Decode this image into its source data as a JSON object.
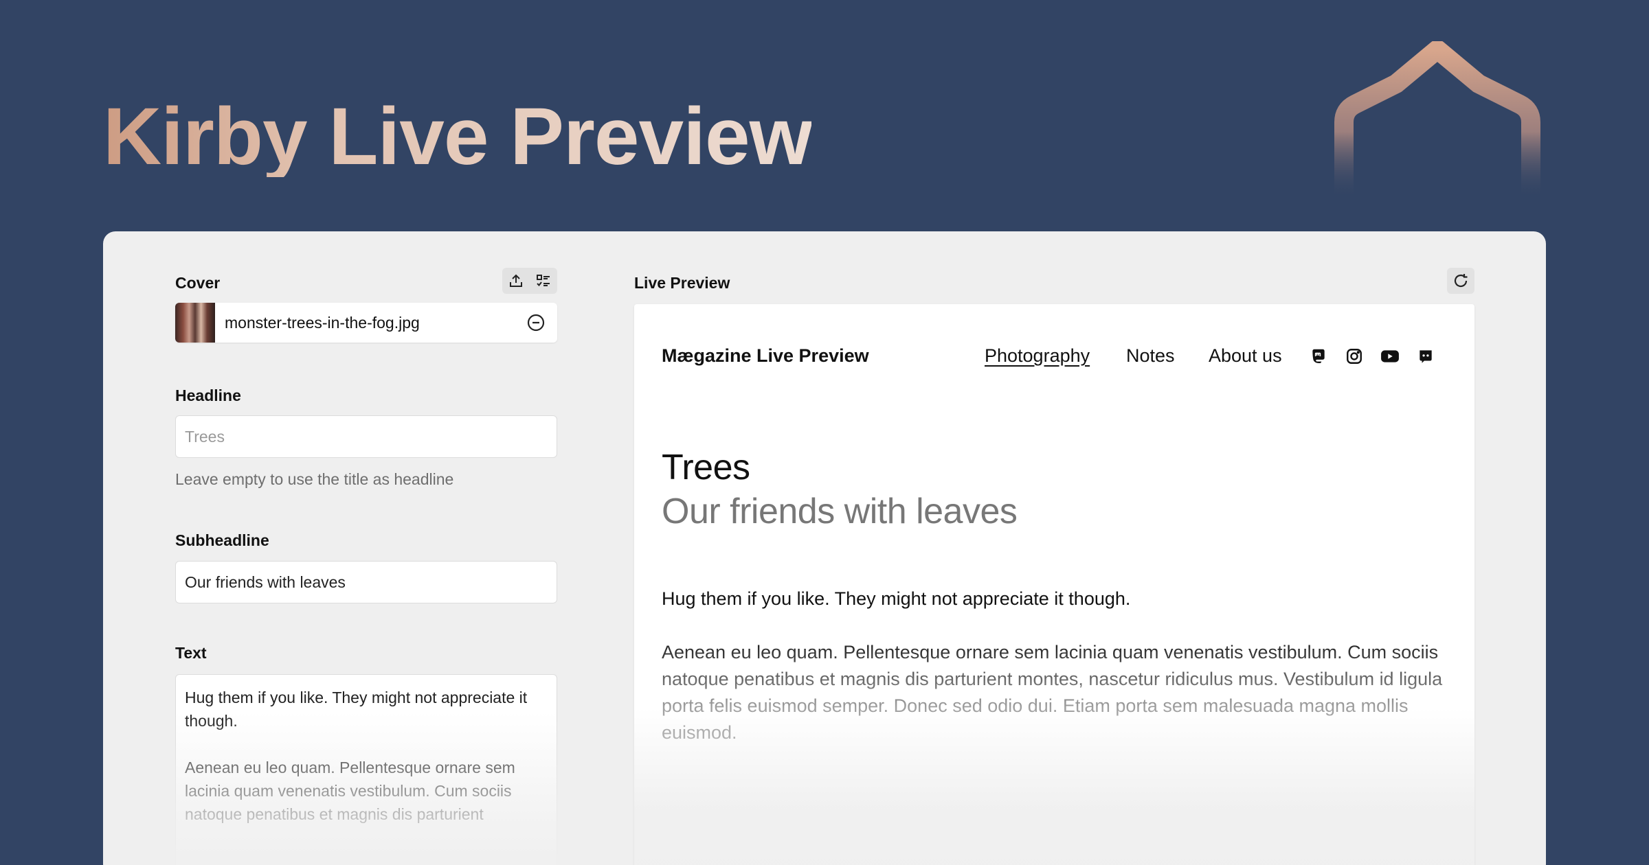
{
  "hero": {
    "title": "Kirby Live Preview"
  },
  "form": {
    "cover": {
      "label": "Cover",
      "filename": "monster-trees-in-the-fog.jpg",
      "upload_icon": "upload-icon",
      "select_icon": "list-select-icon",
      "remove_icon": "remove-circle-icon"
    },
    "headline": {
      "label": "Headline",
      "placeholder": "Trees",
      "help": "Leave empty to use the title as headline"
    },
    "subheadline": {
      "label": "Subheadline",
      "value": "Our friends with leaves"
    },
    "text": {
      "label": "Text",
      "paragraphs": [
        "Hug them if you like. They might not appreciate it though.",
        "Aenean eu leo quam. Pellentesque ornare sem lacinia quam venenatis vestibulum. Cum sociis natoque penatibus et magnis dis parturient"
      ]
    }
  },
  "preview": {
    "label": "Live Preview",
    "refresh_icon": "refresh-icon",
    "site": {
      "brand": "Mægazine Live Preview",
      "nav": [
        "Photography",
        "Notes",
        "About us"
      ],
      "active_nav": "Photography",
      "social_icons": [
        "mastodon-icon",
        "instagram-icon",
        "youtube-icon",
        "discord-icon"
      ]
    },
    "page": {
      "headline": "Trees",
      "subheadline": "Our friends with leaves",
      "paragraphs": [
        "Hug them if you like. They might not appreciate it though.",
        "Aenean eu leo quam. Pellentesque ornare sem lacinia quam venenatis vestibulum. Cum sociis natoque penatibus et magnis dis parturient montes, nascetur ridiculus mus. Vestibulum id ligula porta felis euismod semper. Donec sed odio dui. Etiam porta sem malesuada magna mollis euismod."
      ]
    }
  },
  "colors": {
    "background": "#324464",
    "panel": "#efefef",
    "accent_gradient_start": "#cd9c83",
    "accent_gradient_end": "#eddcd2"
  }
}
